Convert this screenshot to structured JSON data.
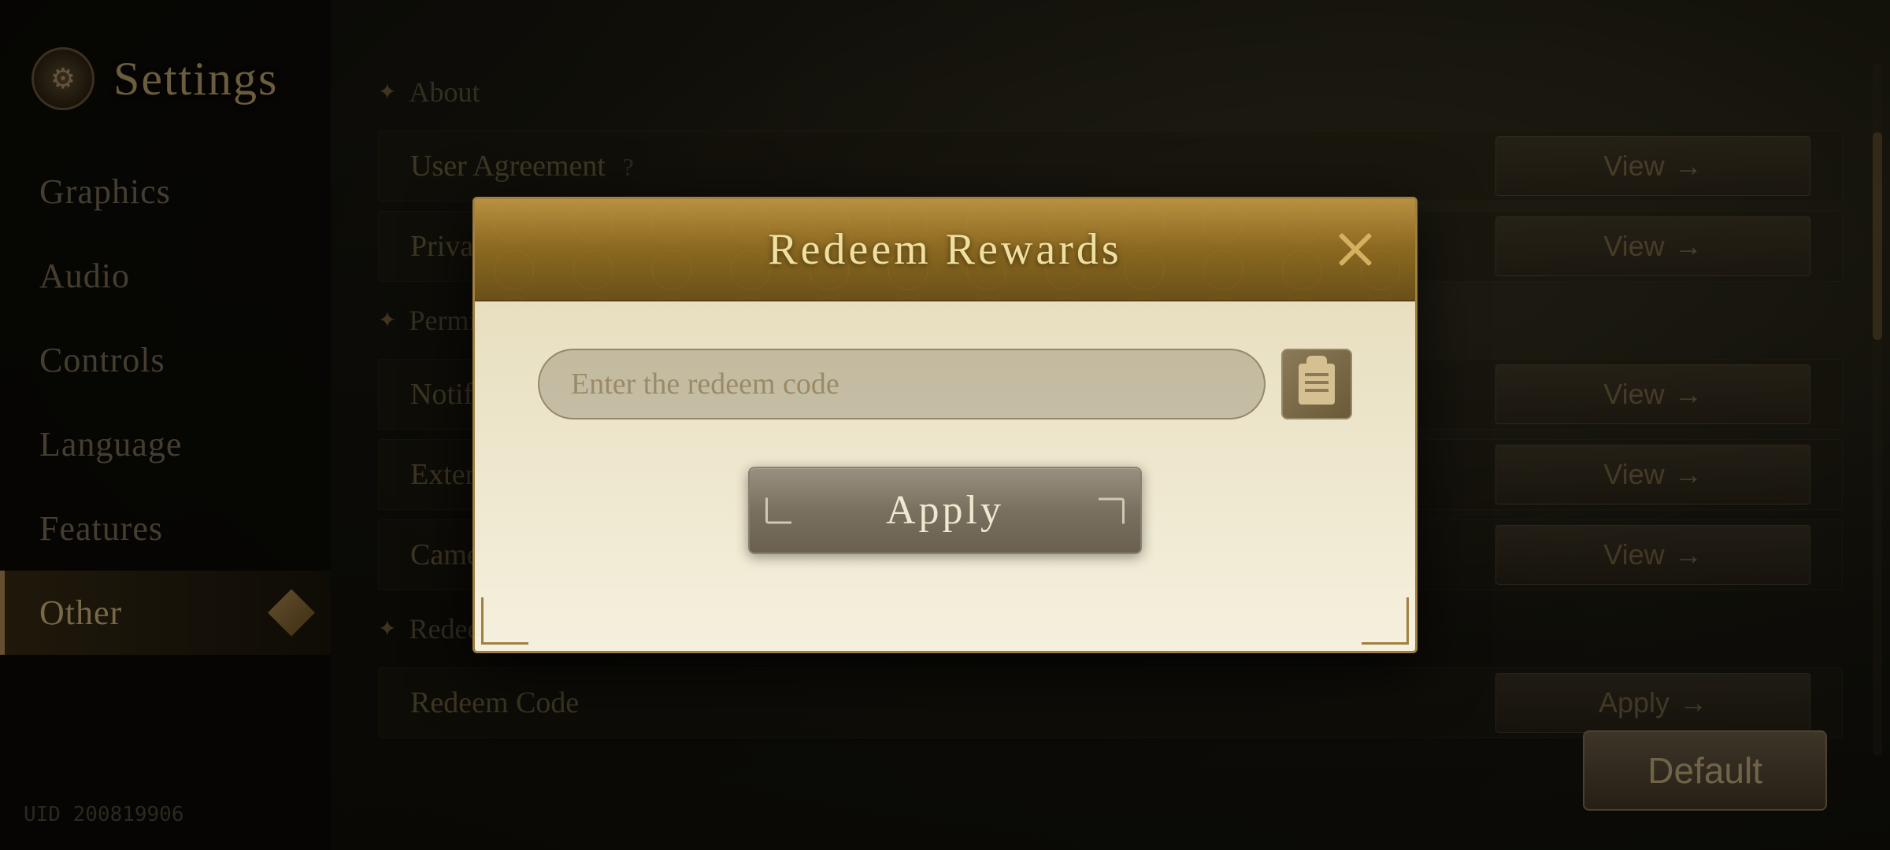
{
  "app": {
    "title": "Settings",
    "uid": "UID 200819906"
  },
  "sidebar": {
    "items": [
      {
        "id": "graphics",
        "label": "Graphics",
        "active": false
      },
      {
        "id": "audio",
        "label": "Audio",
        "active": false
      },
      {
        "id": "controls",
        "label": "Controls",
        "active": false
      },
      {
        "id": "language",
        "label": "Language",
        "active": false
      },
      {
        "id": "features",
        "label": "Features",
        "active": false
      },
      {
        "id": "other",
        "label": "Other",
        "active": true
      }
    ]
  },
  "main": {
    "rows": [
      {
        "id": "about",
        "label": "About",
        "section": true,
        "action": null
      },
      {
        "id": "user-agreement",
        "label": "User Agreement",
        "hasQuestion": true,
        "action": "View →"
      },
      {
        "id": "privacy",
        "label": "Privacy Policy",
        "hasQuestion": false,
        "action": "View →"
      },
      {
        "id": "permissions",
        "label": "Permissions",
        "section": true,
        "action": null
      },
      {
        "id": "notifications",
        "label": "Notification",
        "hasQuestion": false,
        "action": "View →"
      },
      {
        "id": "external-links",
        "label": "External Links",
        "hasQuestion": false,
        "action": "View →"
      },
      {
        "id": "camera",
        "label": "Camera",
        "hasQuestion": false,
        "action": "View →"
      },
      {
        "id": "redeem-section",
        "label": "Redeem Code",
        "section": true,
        "action": null
      },
      {
        "id": "redeem-code",
        "label": "Redeem Code",
        "hasQuestion": false,
        "action": "Apply →"
      }
    ],
    "default_button": "Default"
  },
  "modal": {
    "title": "Redeem Rewards",
    "input_placeholder": "Enter the redeem code",
    "apply_button": "Apply",
    "close_icon": "close-x-icon"
  }
}
